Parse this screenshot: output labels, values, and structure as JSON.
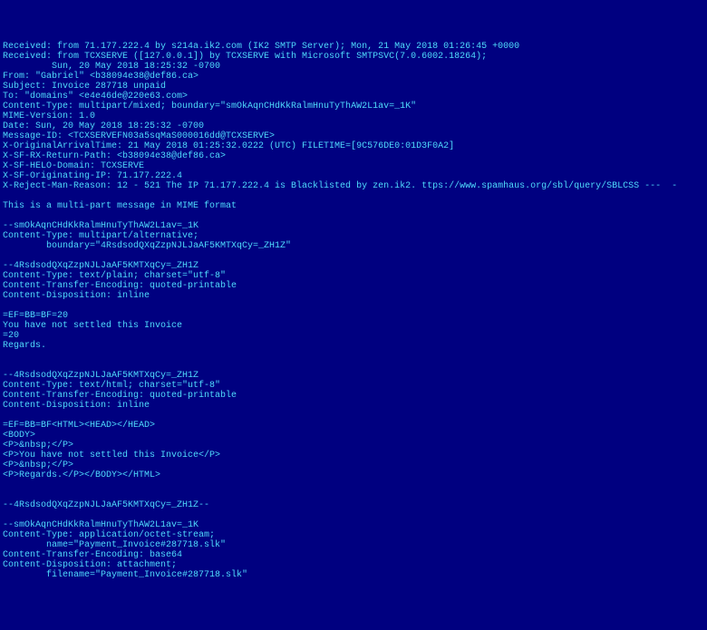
{
  "email": {
    "raw_lines": [
      "Received: from 71.177.222.4 by s214a.ik2.com (IK2 SMTP Server); Mon, 21 May 2018 01:26:45 +0000",
      "Received: from TCXSERVE ([127.0.0.1]) by TCXSERVE with Microsoft SMTPSVC(7.0.6002.18264);",
      "         Sun, 20 May 2018 18:25:32 -0700",
      "From: \"Gabriel\" <b38094e38@def86.ca>",
      "Subject: Invoice 287718 unpaid",
      "To: \"domains\" <e4e46de@220e63.com>",
      "Content-Type: multipart/mixed; boundary=\"smOkAqnCHdKkRalmHnuTyThAW2L1av=_1K\"",
      "MIME-Version: 1.0",
      "Date: Sun, 20 May 2018 18:25:32 -0700",
      "Message-ID: <TCXSERVEFN03a5sqMaS000016dd@TCXSERVE>",
      "X-OriginalArrivalTime: 21 May 2018 01:25:32.0222 (UTC) FILETIME=[9C576DE0:01D3F0A2]",
      "X-SF-RX-Return-Path: <b38094e38@def86.ca>",
      "X-SF-HELO-Domain: TCXSERVE",
      "X-SF-Originating-IP: 71.177.222.4",
      "X-Reject-Man-Reason: 12 - 521 The IP 71.177.222.4 is Blacklisted by zen.ik2. ttps://www.spamhaus.org/sbl/query/SBLCSS ---  -",
      "",
      "This is a multi-part message in MIME format",
      "",
      "--smOkAqnCHdKkRalmHnuTyThAW2L1av=_1K",
      "Content-Type: multipart/alternative;",
      "        boundary=\"4RsdsodQXqZzpNJLJaAF5KMTXqCy=_ZH1Z\"",
      "",
      "--4RsdsodQXqZzpNJLJaAF5KMTXqCy=_ZH1Z",
      "Content-Type: text/plain; charset=\"utf-8\"",
      "Content-Transfer-Encoding: quoted-printable",
      "Content-Disposition: inline",
      "",
      "=EF=BB=BF=20",
      "You have not settled this Invoice",
      "=20",
      "Regards.",
      "",
      "",
      "--4RsdsodQXqZzpNJLJaAF5KMTXqCy=_ZH1Z",
      "Content-Type: text/html; charset=\"utf-8\"",
      "Content-Transfer-Encoding: quoted-printable",
      "Content-Disposition: inline",
      "",
      "=EF=BB=BF<HTML><HEAD></HEAD>",
      "<BODY>",
      "<P>&nbsp;</P>",
      "<P>You have not settled this Invoice</P>",
      "<P>&nbsp;</P>",
      "<P>Regards.</P></BODY></HTML>",
      "",
      "",
      "--4RsdsodQXqZzpNJLJaAF5KMTXqCy=_ZH1Z--",
      "",
      "--smOkAqnCHdKkRalmHnuTyThAW2L1av=_1K",
      "Content-Type: application/octet-stream;",
      "        name=\"Payment_Invoice#287718.slk\"",
      "Content-Transfer-Encoding: base64",
      "Content-Disposition: attachment;",
      "        filename=\"Payment_Invoice#287718.slk\""
    ]
  }
}
